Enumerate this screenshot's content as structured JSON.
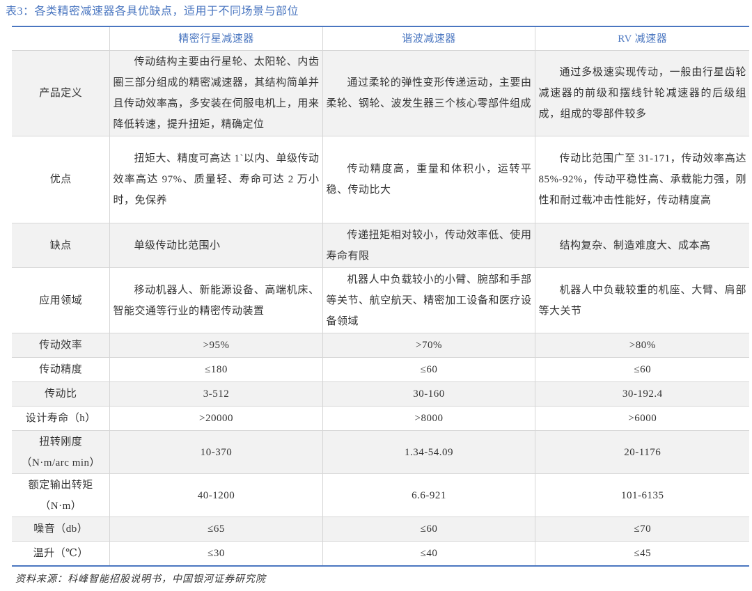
{
  "title": "表3：各类精密减速器各具优缺点，适用于不同场景与部位",
  "colors": {
    "accent": "#4a76c0",
    "row_shade": "#f2f2f2",
    "text": "#333333",
    "grid": "#d6d6d6"
  },
  "table": {
    "columns": [
      "精密行星减速器",
      "谐波减速器",
      "RV 减速器"
    ],
    "rows": [
      {
        "label": [
          "产品定义"
        ],
        "cells": [
          "传动结构主要由行星轮、太阳轮、内齿圈三部分组成的精密减速器，其结构简单并且传动效率高，多安装在伺服电机上，用来降低转速，提升扭矩，精确定位",
          "通过柔轮的弹性变形传递运动，主要由柔轮、钢轮、波发生器三个核心零部件组成",
          "通过多极速实现传动，一般由行星齿轮减速器的前级和摆线针轮减速器的后级组成，组成的零部件较多"
        ]
      },
      {
        "label": [
          "优点"
        ],
        "cells": [
          "扭矩大、精度可高达 1`以内、单级传动效率高达 97%、质量轻、寿命可达 2 万小时，免保养",
          "传动精度高，重量和体积小，运转平稳、传动比大",
          "传动比范围广至 31-171，传动效率高达 85%-92%，传动平稳性高、承载能力强，刚性和耐过载冲击性能好，传动精度高"
        ]
      },
      {
        "label": [
          "缺点"
        ],
        "cells": [
          "单级传动比范围小",
          "传递扭矩相对较小，传动效率低、使用寿命有限",
          "结构复杂、制造难度大、成本高"
        ]
      },
      {
        "label": [
          "应用领域"
        ],
        "cells": [
          "移动机器人、新能源设备、高端机床、智能交通等行业的精密传动装置",
          "机器人中负载较小的小臂、腕部和手部等关节、航空航天、精密加工设备和医疗设备领域",
          "机器人中负载较重的机座、大臂、肩部等大关节"
        ]
      },
      {
        "label": [
          "传动效率"
        ],
        "cells": [
          ">95%",
          ">70%",
          ">80%"
        ]
      },
      {
        "label": [
          "传动精度"
        ],
        "cells": [
          "≤180",
          "≤60",
          "≤60"
        ]
      },
      {
        "label": [
          "传动比"
        ],
        "cells": [
          "3-512",
          "30-160",
          "30-192.4"
        ]
      },
      {
        "label": [
          "设计寿命（h）"
        ],
        "cells": [
          ">20000",
          ">8000",
          ">6000"
        ]
      },
      {
        "label": [
          "扭转刚度",
          "（N·m/arc min）"
        ],
        "cells": [
          "10-370",
          "1.34-54.09",
          "20-1176"
        ]
      },
      {
        "label": [
          "额定输出转矩",
          "（N·m）"
        ],
        "cells": [
          "40-1200",
          "6.6-921",
          "101-6135"
        ]
      },
      {
        "label": [
          "噪音（db）"
        ],
        "cells": [
          "≤65",
          "≤60",
          "≤70"
        ]
      },
      {
        "label": [
          "温升（℃）"
        ],
        "cells": [
          "≤30",
          "≤40",
          "≤45"
        ]
      }
    ]
  },
  "source": "资料来源：科峰智能招股说明书，中国银河证券研究院"
}
